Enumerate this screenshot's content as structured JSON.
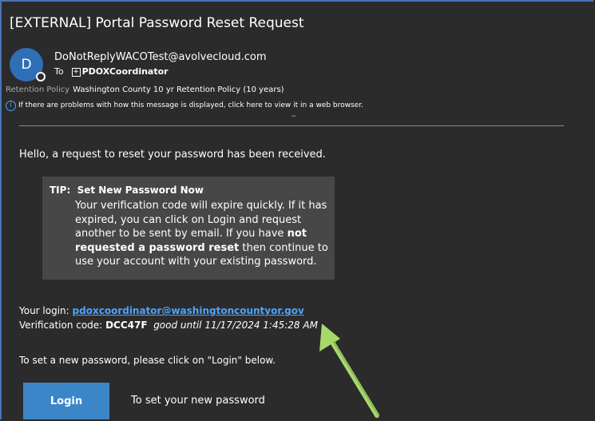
{
  "email": {
    "subject": "[EXTERNAL] Portal Password Reset Request",
    "avatar_initial": "D",
    "sender": "DoNotReplyWACOTest@avolvecloud.com",
    "to_label": "To",
    "to_icon": "expand-box",
    "recipient": "PDOXCoordinator",
    "retention_label": "Retention Policy",
    "retention_value": "Washington County 10 yr Retention Policy (10 years)",
    "info_text": "If there are problems with how this message is displayed, click here to view it in a web browser.",
    "tilde": "~"
  },
  "body": {
    "greeting": "Hello, a request to reset your password has been received.",
    "tip": {
      "label": "TIP:",
      "title": "Set New Password Now",
      "text_1": "Your verification code will expire quickly. If it has expired, you can click on Login and request another to be sent by email. If you have ",
      "bold": "not requested a password reset",
      "text_2": " then continue to use your account with your existing password."
    },
    "login_label": "Your login:",
    "login_value": "pdoxcoordinator@washingtoncountyor.gov",
    "code_label": "Verification code:",
    "code_value": "DCC47F",
    "code_valid": "good until 11/17/2024 1:45:28 AM",
    "instruction": "To set a new password, please click on \"Login\" below.",
    "login_button": "Login",
    "login_button_caption": "To set your new password"
  },
  "colors": {
    "background": "#2b2b2b",
    "link": "#4da3ff",
    "button": "#3b86c8",
    "tip_bg": "#474747",
    "arrow": "#a6d96a"
  }
}
